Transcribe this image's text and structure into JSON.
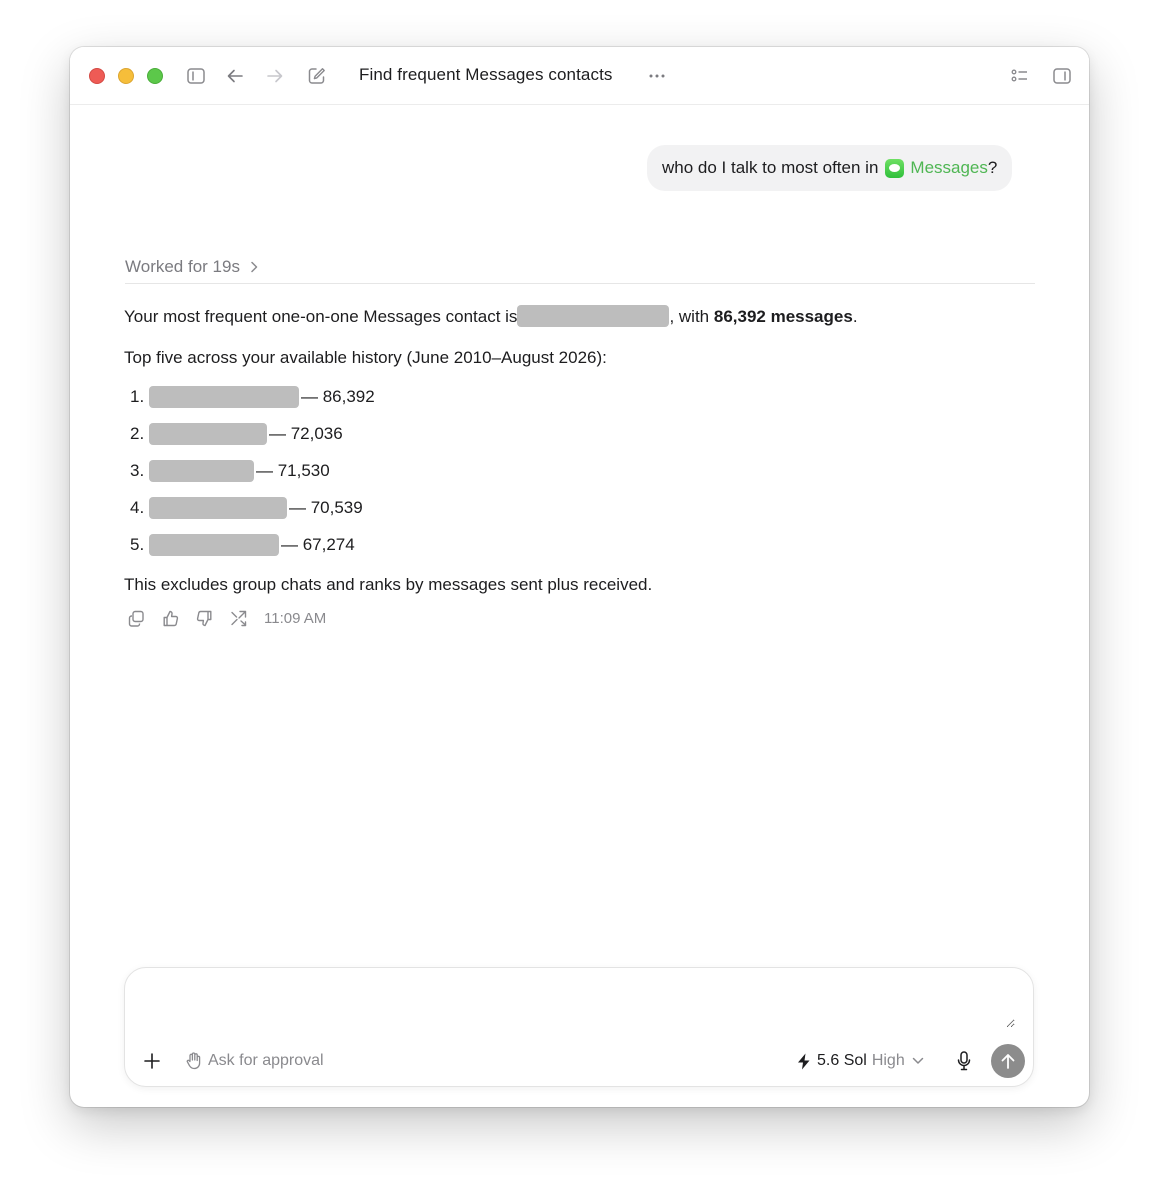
{
  "window": {
    "title": "Find frequent Messages contacts"
  },
  "user_message": {
    "prefix": "who do I talk to most often in",
    "app_name": "Messages",
    "suffix": "?"
  },
  "worked": {
    "label": "Worked for 19s"
  },
  "answer": {
    "p1_before": "Your most frequent one-on-one Messages contact is",
    "p1_middle": ", with",
    "p1_bold": "86,392 messages",
    "p1_end": ".",
    "p2": "Top five across your available history (June 2010–August 2026):",
    "list": [
      {
        "num": "1.",
        "count": "— 86,392"
      },
      {
        "num": "2.",
        "count": "— 72,036"
      },
      {
        "num": "3.",
        "count": "— 71,530"
      },
      {
        "num": "4.",
        "count": "— 70,539"
      },
      {
        "num": "5.",
        "count": "— 67,274"
      }
    ],
    "p3": "This excludes group chats and ranks by messages sent plus received."
  },
  "message_actions": {
    "timestamp": "11:09 AM",
    "icons": [
      "copy-icon",
      "thumbs-up-icon",
      "thumbs-down-icon",
      "branch-icon"
    ]
  },
  "composer": {
    "placeholder": "",
    "approval_label": "Ask for approval",
    "model_name": "5.6 Sol",
    "effort_level": "High"
  },
  "colors": {
    "traffic_red": "#ee5b55",
    "traffic_yellow": "#f6be3a",
    "traffic_green": "#5cc84a",
    "messages_green": "#4fb653",
    "redaction_gray": "#bdbdbd",
    "send_button": "#8c8c8c"
  }
}
